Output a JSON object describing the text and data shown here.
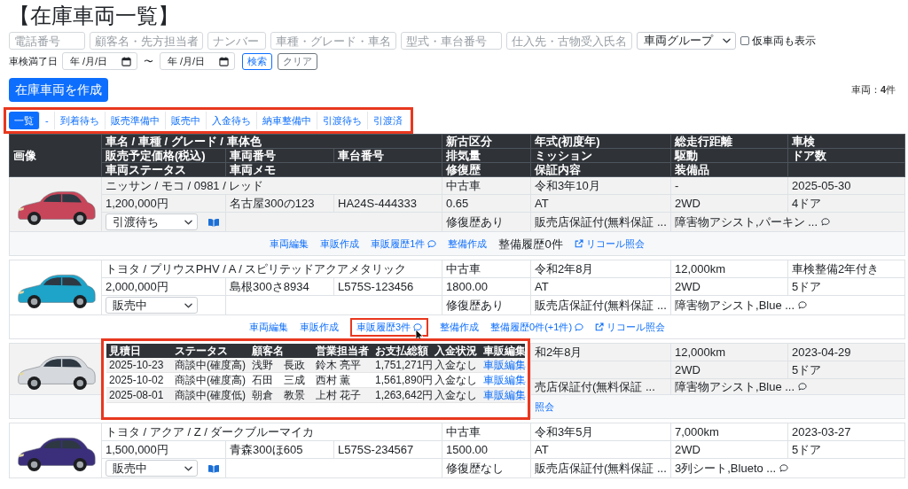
{
  "page": {
    "title": "【在庫車両一覧】"
  },
  "filters": {
    "text_fields": [
      {
        "placeholder": "電話番号"
      },
      {
        "placeholder": "顧客名・先方担当者"
      },
      {
        "placeholder": "ナンバー"
      },
      {
        "placeholder": "車種・グレード・車名"
      },
      {
        "placeholder": "型式・車台番号"
      },
      {
        "placeholder": "仕入先・古物受入氏名"
      }
    ],
    "group_select": {
      "value": "車両グループ"
    },
    "temporary_vehicles": {
      "label": "仮車両も表示",
      "checked": false
    },
    "inspection_date": {
      "label": "車検満了日",
      "from": {
        "placeholder": "年 /月/日"
      },
      "separator": "〜",
      "to": {
        "placeholder": "年 /月/日"
      }
    },
    "buttons": [
      {
        "label": "検索",
        "kind": "primary"
      },
      {
        "label": "クリア",
        "kind": "secondary"
      }
    ]
  },
  "create_button": {
    "label": "在庫車両を作成"
  },
  "vehicle_count": "車両：**4**件",
  "tabs": [
    {
      "label": "一覧",
      "selected": true
    },
    {
      "label": "-",
      "selected": false
    },
    {
      "label": "到着待ち",
      "selected": false
    },
    {
      "label": "販売準備中",
      "selected": false
    },
    {
      "label": "販売中",
      "selected": false
    },
    {
      "label": "入金待ち",
      "selected": false
    },
    {
      "label": "納車整備中",
      "selected": false
    },
    {
      "label": "引渡待ち",
      "selected": false
    },
    {
      "label": "引渡済",
      "selected": false
    }
  ],
  "table": {
    "columns": {
      "image": "画像",
      "name": "車名 / 車種 / グレード / 車体色",
      "condition": "新古区分",
      "year": "年式(初度年)",
      "mileage": "総走行距離",
      "inspection": "車検",
      "price": "販売予定価格(税込)",
      "plate": "車両番号",
      "chassis": "車台番号",
      "displacement": "排気量",
      "transmission": "ミッション",
      "drive": "駆動",
      "doors": "ドア数",
      "status": "車両ステータス",
      "memo": "車両メモ",
      "repair": "修復歴",
      "warranty": "保証内容",
      "equipment": "装備品"
    },
    "vehicles": [
      {
        "color": "#c8465a",
        "name": "ニッサン / モコ / 0981 / レッド",
        "condition": "中古車",
        "year": "令和3年10月",
        "mileage": "-",
        "inspection": "2025-05-30",
        "price": "1,200,000円",
        "plate": "名古屋300の123",
        "chassis": "HA24S-444333",
        "displacement": "0.65",
        "transmission": "AT",
        "drive": "2WD",
        "doors": "4ドア",
        "status": "引渡待ち",
        "show_book": true,
        "repair": "修復歴あり",
        "warranty": "販売店保証付(無料保証 ...",
        "equipment": "障害物アシスト,パーキン ...",
        "actions": [
          {
            "label": "車両編集",
            "kind": "link",
            "expanded": false
          },
          {
            "label": "車販作成",
            "kind": "link",
            "expanded": false
          },
          {
            "label": "車販履歴1件",
            "kind": "comment_link",
            "expanded": false
          },
          {
            "label": "整備作成",
            "kind": "link",
            "expanded": false
          },
          {
            "label": "整備履歴0件",
            "kind": "text",
            "expanded": false
          },
          {
            "label": "リコール照会",
            "kind": "external_link",
            "expanded": false
          }
        ]
      },
      {
        "color": "#1ea3c9",
        "name": "トヨタ / プリウスPHV / A / スピリテッドアクアメタリック",
        "condition": "中古車",
        "year": "令和2年8月",
        "mileage": "12,000km",
        "inspection": "車検整備2年付き",
        "price": "2,000,000円",
        "plate": "島根300さ8934",
        "chassis": "L575S-123456",
        "displacement": "1800.00",
        "transmission": "AT",
        "drive": "2WD",
        "doors": "5ドア",
        "status": "販売中",
        "show_book": false,
        "repair": "修復歴あり",
        "warranty": "販売店保証付(無料保証 ...",
        "equipment": "障害物アシスト,Blue ...",
        "actions": [
          {
            "label": "車両編集",
            "kind": "link",
            "expanded": false
          },
          {
            "label": "車販作成",
            "kind": "link",
            "expanded": false
          },
          {
            "label": "車販履歴3件",
            "kind": "comment_link",
            "expanded": true,
            "popup": {
              "columns": [
                {
                  "label": "見積日",
                  "kind": "text"
                },
                {
                  "label": "ステータス",
                  "kind": "text"
                },
                {
                  "label": "顧客名",
                  "kind": "text"
                },
                {
                  "label": "営業担当者",
                  "kind": "text"
                },
                {
                  "label": "お支払総額",
                  "kind": "text"
                },
                {
                  "label": "入金状況",
                  "kind": "text"
                },
                {
                  "label": "車販編集",
                  "kind": "link"
                }
              ],
              "rows": [
                [
                  "2025-10-23",
                  "商談中(確度高)",
                  "浅野　長政",
                  "鈴木 亮平",
                  "1,751,271円",
                  "入金なし",
                  "車販編集"
                ],
                [
                  "2025-10-02",
                  "商談中(確度高)",
                  "石田　三成",
                  "西村 薫",
                  "1,561,890円",
                  "入金なし",
                  "車販編集"
                ],
                [
                  "2025-08-01",
                  "商談中(確度低)",
                  "朝倉　教景",
                  "上村 花子",
                  "1,263,642円",
                  "入金なし",
                  "車販編集"
                ]
              ]
            }
          },
          {
            "label": "整備作成",
            "kind": "link",
            "expanded": false
          },
          {
            "label": "整備履歴0件(+1件)",
            "kind": "comment_link",
            "expanded": false
          },
          {
            "label": "リコール照会",
            "kind": "external_link",
            "expanded": false
          }
        ]
      },
      {
        "color": "#d5d9de",
        "year": "和2年8月",
        "mileage": "12,000km",
        "inspection": "2023-04-29",
        "drive": "2WD",
        "doors": "5ドア",
        "show_book": false,
        "warranty": "売店保証付(無料保証 ...",
        "equipment": "障害物アシスト,Blue ...",
        "actions": [
          {
            "label": "照会",
            "kind": "link",
            "expanded": false
          }
        ]
      },
      {
        "color": "#3b2f7c",
        "name": "トヨタ / アクア / Z / ダークブルーマイカ",
        "condition": "中古車",
        "year": "令和3年5月",
        "mileage": "7,000km",
        "inspection": "2023-03-27",
        "price": "1,500,000円",
        "plate": "青森300ほ605",
        "chassis": "L575S-234567",
        "displacement": "1500.00",
        "transmission": "AT",
        "drive": "2WD",
        "doors": "5ドア",
        "status": "販売中",
        "show_book": true,
        "repair": "修復歴なし",
        "warranty": "販売店保証付(無料保証 ...",
        "equipment": "3列シート,Blueto ..."
      }
    ]
  }
}
